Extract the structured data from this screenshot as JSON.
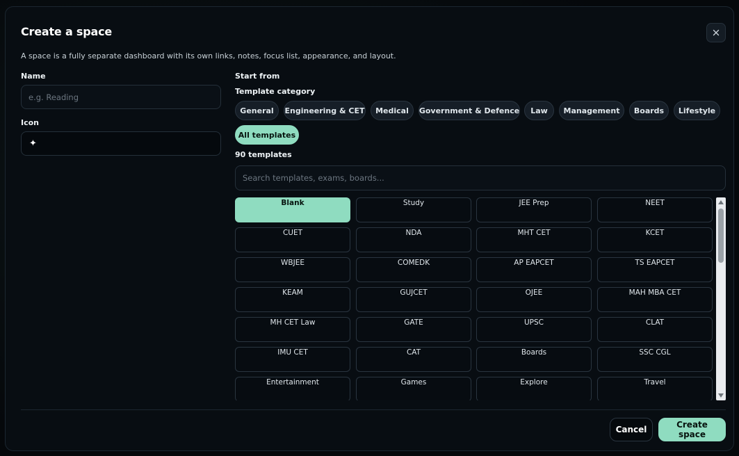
{
  "dialog": {
    "title": "Create a space",
    "subtitle": "A space is a fully separate dashboard with its own links, notes, focus list, appearance, and layout.",
    "close_icon": "close-icon"
  },
  "name_field": {
    "label": "Name",
    "placeholder": "e.g. Reading",
    "value": ""
  },
  "icon_field": {
    "label": "Icon",
    "value": "✦"
  },
  "templates": {
    "start_from_label": "Start from",
    "category_label": "Template category",
    "categories": [
      {
        "label": "General",
        "active": false
      },
      {
        "label": "Engineering & CET",
        "active": false
      },
      {
        "label": "Medical",
        "active": false
      },
      {
        "label": "Government & Defence",
        "active": false
      },
      {
        "label": "Law",
        "active": false
      },
      {
        "label": "Management",
        "active": false
      },
      {
        "label": "Boards",
        "active": false
      },
      {
        "label": "Lifestyle",
        "active": false
      },
      {
        "label": "All templates",
        "active": true
      }
    ],
    "count_label": "90 templates",
    "search_placeholder": "Search templates, exams, boards...",
    "items": [
      {
        "label": "Blank",
        "active": true
      },
      {
        "label": "Study",
        "active": false
      },
      {
        "label": "JEE Prep",
        "active": false
      },
      {
        "label": "NEET",
        "active": false
      },
      {
        "label": "CUET",
        "active": false
      },
      {
        "label": "NDA",
        "active": false
      },
      {
        "label": "MHT CET",
        "active": false
      },
      {
        "label": "KCET",
        "active": false
      },
      {
        "label": "WBJEE",
        "active": false
      },
      {
        "label": "COMEDK",
        "active": false
      },
      {
        "label": "AP EAPCET",
        "active": false
      },
      {
        "label": "TS EAPCET",
        "active": false
      },
      {
        "label": "KEAM",
        "active": false
      },
      {
        "label": "GUJCET",
        "active": false
      },
      {
        "label": "OJEE",
        "active": false
      },
      {
        "label": "MAH MBA CET",
        "active": false
      },
      {
        "label": "MH CET Law",
        "active": false
      },
      {
        "label": "GATE",
        "active": false
      },
      {
        "label": "UPSC",
        "active": false
      },
      {
        "label": "CLAT",
        "active": false
      },
      {
        "label": "IMU CET",
        "active": false
      },
      {
        "label": "CAT",
        "active": false
      },
      {
        "label": "Boards",
        "active": false
      },
      {
        "label": "SSC CGL",
        "active": false
      },
      {
        "label": "Entertainment",
        "active": false
      },
      {
        "label": "Games",
        "active": false
      },
      {
        "label": "Explore",
        "active": false
      },
      {
        "label": "Travel",
        "active": false
      }
    ]
  },
  "footer": {
    "cancel_label": "Cancel",
    "create_label": "Create space"
  },
  "colors": {
    "accent": "#8fdcc0",
    "background": "#080d12"
  }
}
